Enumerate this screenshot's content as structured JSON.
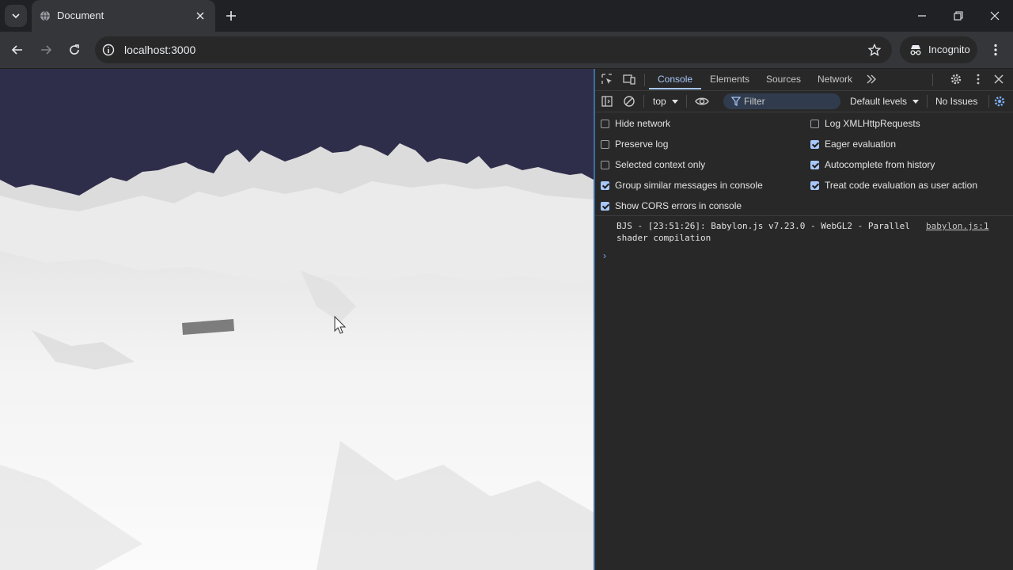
{
  "browser": {
    "tab": {
      "title": "Document"
    },
    "address": {
      "url": "localhost:3000"
    },
    "profile": {
      "label": "Incognito"
    }
  },
  "icons": {
    "tab_search": "chevron-down-icon",
    "favicon": "globe-icon",
    "tab_close": "close-icon",
    "new_tab": "plus-icon",
    "minimize": "minimize-icon",
    "restore": "restore-icon",
    "close": "close-icon",
    "back": "back-arrow-icon",
    "forward": "forward-arrow-icon",
    "reload": "reload-icon",
    "bookmark": "star-icon",
    "menu": "kebab-menu-icon"
  },
  "devtools": {
    "tabs": [
      {
        "label": "Console",
        "active": true
      },
      {
        "label": "Elements"
      },
      {
        "label": "Sources"
      },
      {
        "label": "Network"
      }
    ],
    "toolbar": {
      "context": "top",
      "filter_placeholder": "Filter",
      "levels": "Default levels",
      "issues": "No Issues"
    },
    "settings": [
      {
        "label": "Hide network",
        "checked": false
      },
      {
        "label": "Preserve log",
        "checked": false
      },
      {
        "label": "Selected context only",
        "checked": false
      },
      {
        "label": "Group similar messages in console",
        "checked": true
      },
      {
        "label": "Show CORS errors in console",
        "checked": true
      },
      {
        "label": "Log XMLHttpRequests",
        "checked": false
      },
      {
        "label": "Eager evaluation",
        "checked": true
      },
      {
        "label": "Autocomplete from history",
        "checked": true
      },
      {
        "label": "Treat code evaluation as user action",
        "checked": true
      }
    ],
    "console": {
      "message": "BJS - [23:51:26]: Babylon.js v7.23.0 - WebGL2 - Parallel\nshader compilation",
      "source": "babylon.js:1",
      "prompt": "›"
    }
  },
  "colors": {
    "sky": "#2f2e4a",
    "snow": "#f4f4f4",
    "accent": "#a8c7fa",
    "panel": "#282828"
  }
}
